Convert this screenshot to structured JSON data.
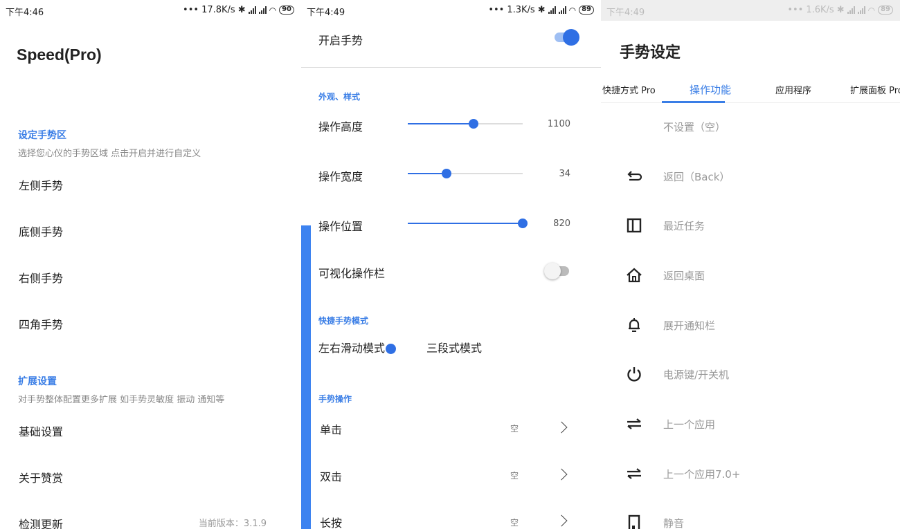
{
  "panel1": {
    "status": {
      "time": "下午4:46",
      "speed": "17.8K/s",
      "battery": "90"
    },
    "title": "Speed(Pro)",
    "section1": {
      "heading": "设定手势区",
      "subtitle": "选择您心仪的手势区域 点击开启并进行自定义"
    },
    "gesture_items": [
      "左侧手势",
      "底侧手势",
      "右侧手势",
      "四角手势"
    ],
    "section2": {
      "heading": "扩展设置",
      "subtitle": "对手势整体配置更多扩展 如手势灵敏度 振动 通知等"
    },
    "ext_items": [
      "基础设置",
      "关于赞赏",
      "检测更新"
    ],
    "version": "当前版本：3.1.9"
  },
  "panel2": {
    "status": {
      "time": "下午4:49",
      "speed": "1.3K/s",
      "battery": "89"
    },
    "enable_label": "开启手势",
    "enable_on": true,
    "appearance_heading": "外观、样式",
    "sliders": [
      {
        "label": "操作高度",
        "value": "1100",
        "fraction": 0.57
      },
      {
        "label": "操作宽度",
        "value": "34",
        "fraction": 0.34
      },
      {
        "label": "操作位置",
        "value": "820",
        "fraction": 1.0
      }
    ],
    "visual_bar_label": "可视化操作栏",
    "visual_bar_on": false,
    "quick_mode_heading": "快捷手势模式",
    "modes": [
      "左右滑动模式",
      "三段式模式"
    ],
    "operation_heading": "手势操作",
    "operations": [
      {
        "label": "单击",
        "value": "空"
      },
      {
        "label": "双击",
        "value": "空"
      },
      {
        "label": "长按",
        "value": "空"
      }
    ]
  },
  "panel3": {
    "status": {
      "time": "下午4:49",
      "speed": "1.6K/s",
      "battery": "89"
    },
    "title": "手势设定",
    "tabs": [
      "快捷方式 Pro",
      "操作功能",
      "应用程序",
      "扩展面板 Pro"
    ],
    "active_tab": 1,
    "actions": [
      {
        "label": "不设置（空）",
        "icon": "none"
      },
      {
        "label": "返回（Back）",
        "icon": "back-icon"
      },
      {
        "label": "最近任务",
        "icon": "recents-icon"
      },
      {
        "label": "返回桌面",
        "icon": "home-icon"
      },
      {
        "label": "展开通知栏",
        "icon": "bell-icon"
      },
      {
        "label": "电源键/开关机",
        "icon": "power-icon"
      },
      {
        "label": "上一个应用",
        "icon": "switch-app-icon"
      },
      {
        "label": "上一个应用7.0+",
        "icon": "switch-app-icon"
      },
      {
        "label": "静音",
        "icon": "mute-icon"
      }
    ],
    "accent": "#3a7ee6"
  }
}
